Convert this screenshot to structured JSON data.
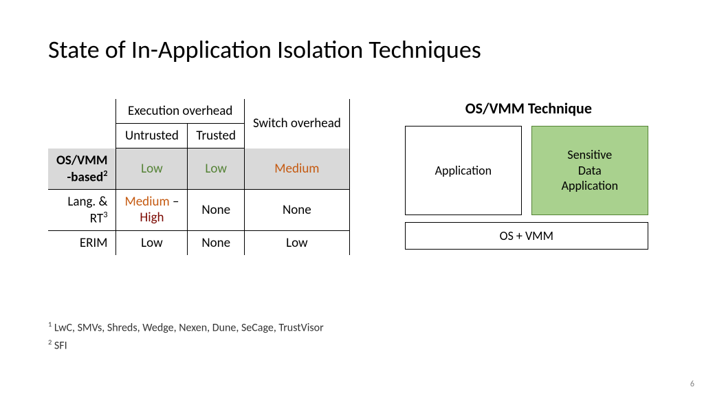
{
  "title": "State of In-Application Isolation Techniques",
  "table": {
    "headers": {
      "exec": "Execution overhead",
      "switch": "Switch overhead",
      "untrusted": "Untrusted",
      "trusted": "Trusted"
    },
    "rows": {
      "osvmm": {
        "label_l1": "OS/VMM",
        "label_l2": "-based",
        "sup": "2",
        "untrusted": "Low",
        "trusted": "Low",
        "switch": "Medium"
      },
      "langrt": {
        "label_l1": "Lang. &",
        "label_l2": "RT",
        "sup": "3",
        "untrusted_p1": "Medium",
        "untrusted_sep": " – ",
        "untrusted_p2": "High",
        "trusted": "None",
        "switch": "None"
      },
      "erim": {
        "label": "ERIM",
        "untrusted": "Low",
        "trusted": "None",
        "switch": "Low"
      }
    }
  },
  "diagram": {
    "title": "OS/VMM Technique",
    "app": "Application",
    "sens_l1": "Sensitive",
    "sens_l2": "Data",
    "sens_l3": "Application",
    "os": "OS + VMM"
  },
  "footnotes": {
    "f1_sup": "1",
    "f1": " LwC, SMVs, Shreds, Wedge, Nexen, Dune, SeCage, TrustVisor",
    "f2_sup": "2",
    "f2": " SFI"
  },
  "page": "6"
}
